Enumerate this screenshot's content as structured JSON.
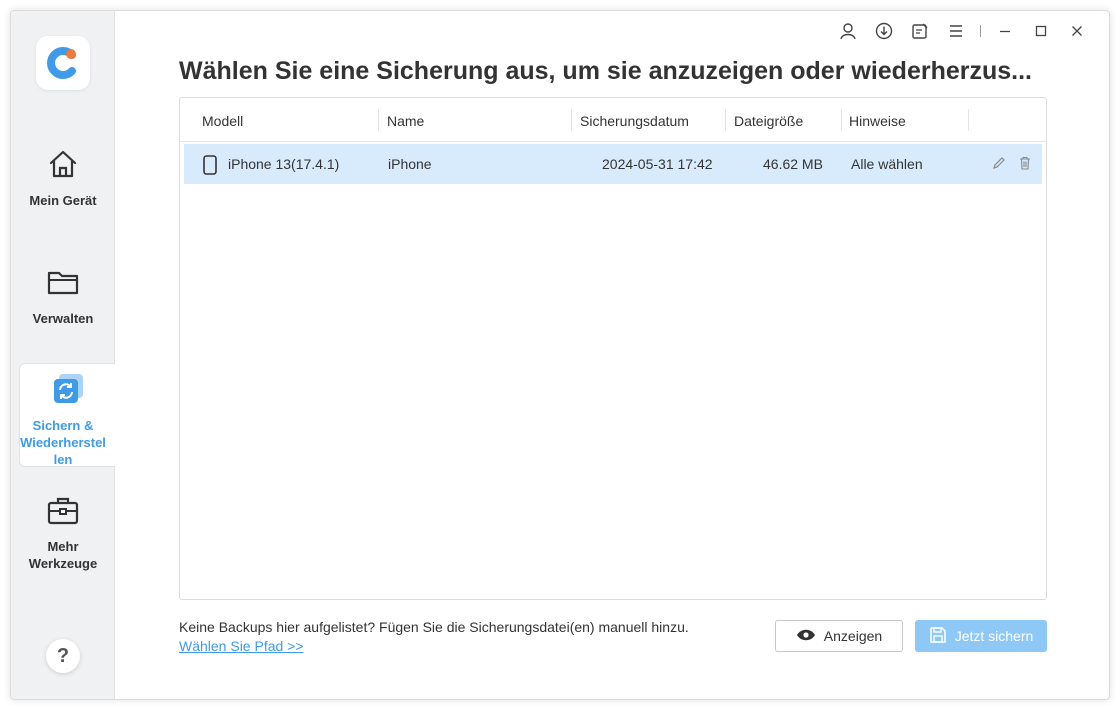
{
  "app": {
    "title": "Wählen Sie eine Sicherung aus, um sie anzuzeigen oder wiederherzus...",
    "accent_color": "#3d9be9",
    "logo_icon": "app-logo-icon"
  },
  "window_controls": {
    "account_icon": "user-icon",
    "download_icon": "download-icon",
    "feedback_icon": "feedback-icon",
    "menu_icon": "menu-icon",
    "minimize_icon": "minimize-icon",
    "maximize_icon": "maximize-icon",
    "close_icon": "close-icon"
  },
  "sidebar": {
    "items": [
      {
        "label": "Mein Gerät",
        "icon": "home-icon",
        "active": false
      },
      {
        "label": "Verwalten",
        "icon": "folder-icon",
        "active": false
      },
      {
        "label": "Sichern & Wiederherstel len",
        "icon": "backup-restore-icon",
        "active": true
      },
      {
        "label": "Mehr Werkzeuge",
        "icon": "toolbox-icon",
        "active": false
      }
    ],
    "help_label": "?"
  },
  "table": {
    "columns": [
      "Modell",
      "Name",
      "Sicherungsdatum",
      "Dateigröße",
      "Hinweise"
    ],
    "rows": [
      {
        "model": "iPhone 13(17.4.1)",
        "name": "iPhone",
        "date": "2024-05-31 17:42",
        "size": "46.62 MB",
        "note": "Alle wählen",
        "selected": true
      }
    ]
  },
  "footer": {
    "note": "Keine Backups hier aufgelistet? Fügen Sie die Sicherungsdatei(en) manuell hinzu.",
    "link": "Wählen Sie Pfad >>",
    "view_button": "Anzeigen",
    "backup_button": "Jetzt sichern"
  }
}
